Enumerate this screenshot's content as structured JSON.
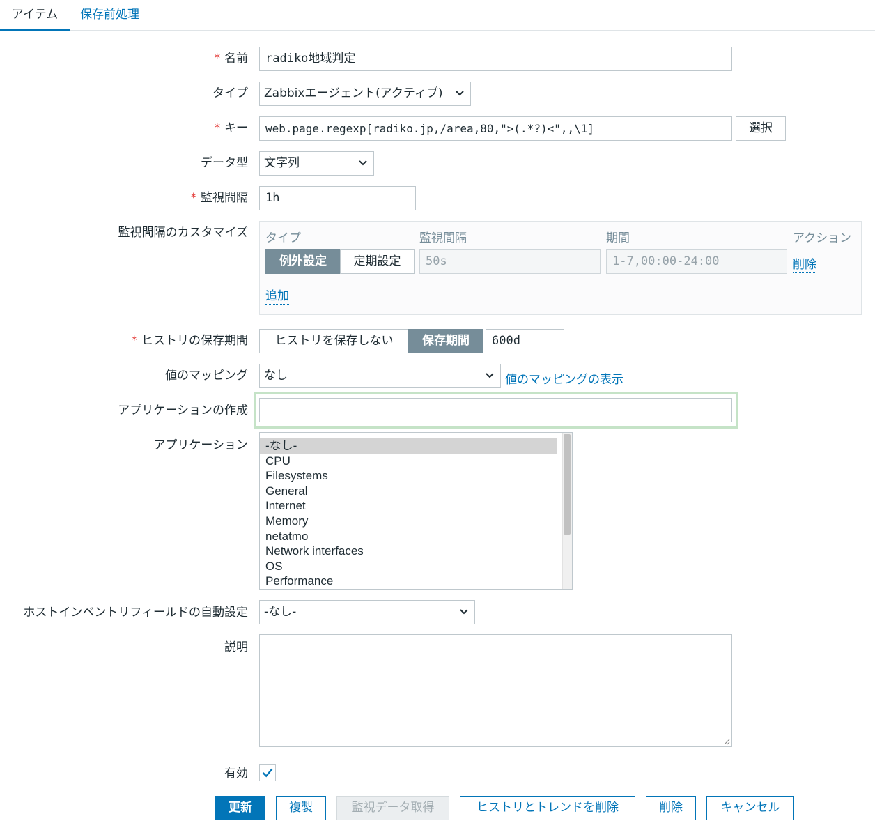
{
  "tabs": [
    {
      "label": "アイテム",
      "active": true
    },
    {
      "label": "保存前処理",
      "active": false
    }
  ],
  "form": {
    "name": {
      "label": "名前",
      "value": "radiko地域判定",
      "required": true
    },
    "type": {
      "label": "タイプ",
      "value": "Zabbixエージェント(アクティブ)"
    },
    "key": {
      "label": "キー",
      "value": "web.page.regexp[radiko.jp,/area,80,\">(.*?)<\",,\\1]",
      "required": true,
      "select_button": "選択"
    },
    "data_type": {
      "label": "データ型",
      "value": "文字列"
    },
    "interval": {
      "label": "監視間隔",
      "value": "1h",
      "required": true
    },
    "custom_intervals": {
      "label": "監視間隔のカスタマイズ",
      "headers": {
        "type": "タイプ",
        "interval": "監視間隔",
        "period": "期間",
        "action": "アクション"
      },
      "type_options": [
        "例外設定",
        "定期設定"
      ],
      "type_selected": "例外設定",
      "interval_placeholder": "50s",
      "period_placeholder": "1-7,00:00-24:00",
      "remove_label": "削除",
      "add_label": "追加"
    },
    "history": {
      "label": "ヒストリの保存期間",
      "required": true,
      "options": [
        "ヒストリを保存しない",
        "保存期間"
      ],
      "selected": "保存期間",
      "value": "600d"
    },
    "value_map": {
      "label": "値のマッピング",
      "value": "なし",
      "link": "値のマッピングの表示"
    },
    "new_application": {
      "label": "アプリケーションの作成",
      "value": ""
    },
    "applications": {
      "label": "アプリケーション",
      "options": [
        "-なし-",
        "CPU",
        "Filesystems",
        "General",
        "Internet",
        "Memory",
        "netatmo",
        "Network interfaces",
        "OS",
        "Performance"
      ],
      "selected": "-なし-"
    },
    "inventory": {
      "label": "ホストインベントリフィールドの自動設定",
      "value": "-なし-"
    },
    "description": {
      "label": "説明",
      "value": ""
    },
    "enabled": {
      "label": "有効",
      "checked": true
    }
  },
  "buttons": {
    "update": "更新",
    "clone": "複製",
    "check_now": "監視データ取得",
    "clear_history": "ヒストリとトレンドを削除",
    "delete": "削除",
    "cancel": "キャンセル"
  },
  "colors": {
    "accent": "#0275b8",
    "required": "#e33734",
    "segment_on": "#768d99",
    "focus_ring": "#c5e3c7"
  }
}
